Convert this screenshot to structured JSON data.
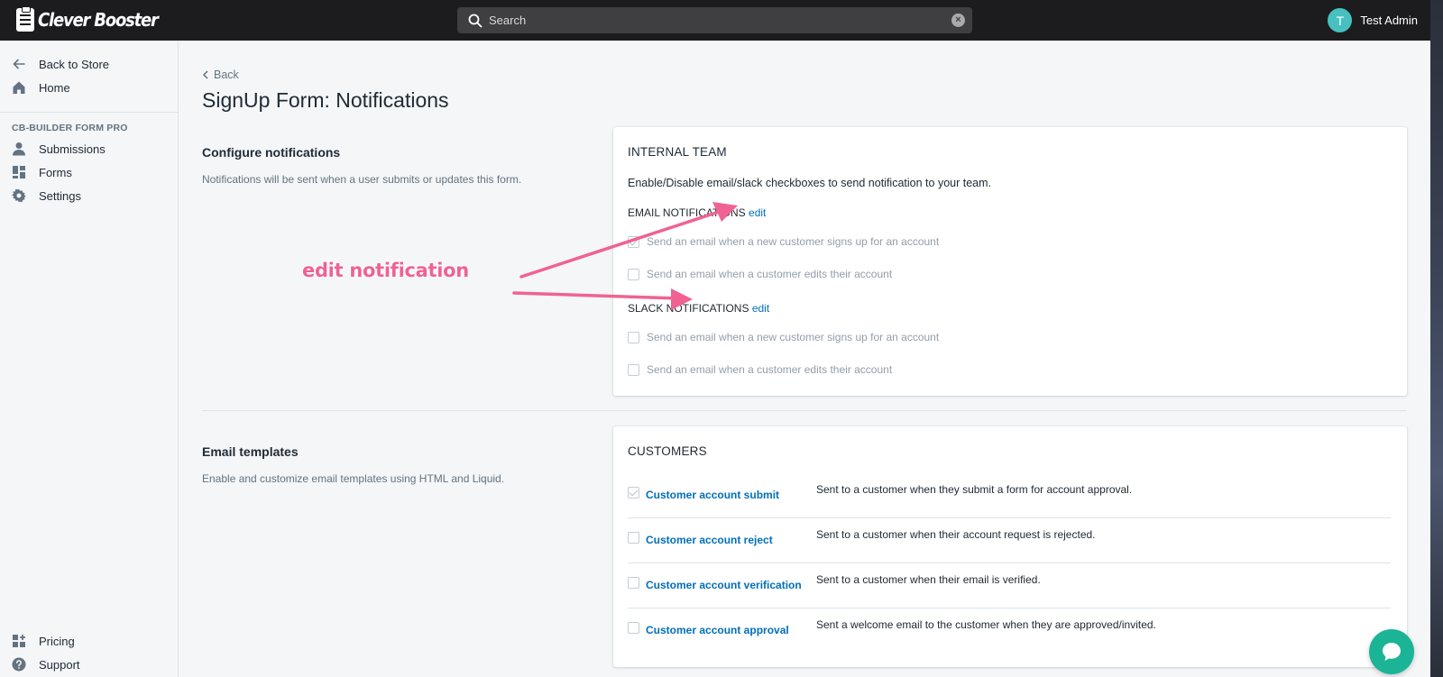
{
  "app": {
    "name": "Clever Booster"
  },
  "search": {
    "placeholder": "Search"
  },
  "user": {
    "initial": "T",
    "name": "Test Admin"
  },
  "sidebar": {
    "top_items": [
      {
        "label": "Back to Store",
        "icon": "arrow-left-icon"
      },
      {
        "label": "Home",
        "icon": "home-icon"
      }
    ],
    "section_title": "CB-BUILDER FORM PRO",
    "section_items": [
      {
        "label": "Submissions",
        "icon": "user-icon"
      },
      {
        "label": "Forms",
        "icon": "forms-icon"
      },
      {
        "label": "Settings",
        "icon": "gear-icon"
      }
    ],
    "bottom_items": [
      {
        "label": "Pricing",
        "icon": "apps-icon"
      },
      {
        "label": "Support",
        "icon": "help-icon"
      }
    ]
  },
  "page": {
    "back_label": "Back",
    "title": "SignUp Form: Notifications"
  },
  "configure": {
    "title": "Configure notifications",
    "description": "Notifications will be sent when a user submits or updates this form."
  },
  "internal_team": {
    "heading": "INTERNAL TEAM",
    "description": "Enable/Disable email/slack checkboxes to send notification to your team.",
    "email_heading": "EMAIL NOTIFICATIONS",
    "email_edit": "edit",
    "email_options": [
      {
        "label": "Send an email when a new customer signs up for an account",
        "checked": true
      },
      {
        "label": "Send an email when a customer edits their account",
        "checked": false
      }
    ],
    "slack_heading": "SLACK NOTIFICATIONS",
    "slack_edit": "edit",
    "slack_options": [
      {
        "label": "Send an email when a new customer signs up for an account",
        "checked": false
      },
      {
        "label": "Send an email when a customer edits their account",
        "checked": false
      }
    ]
  },
  "templates": {
    "title": "Email templates",
    "description": "Enable and customize email templates using HTML and Liquid."
  },
  "customers": {
    "heading": "CUSTOMERS",
    "rows": [
      {
        "name": "Customer account submit",
        "description": "Sent to a customer when they submit a form for account approval.",
        "checked": true
      },
      {
        "name": "Customer account reject",
        "description": "Sent to a customer when their account request is rejected.",
        "checked": false
      },
      {
        "name": "Customer account verification",
        "description": "Sent to a customer when their email is verified.",
        "checked": false
      },
      {
        "name": "Customer account approval",
        "description": "Sent a welcome email to the customer when they are approved/invited.",
        "checked": false
      }
    ]
  },
  "annotation": {
    "text": "edit notification",
    "color": "#f06292"
  },
  "colors": {
    "link": "#006fbb",
    "topbar": "#1c1c1e",
    "avatar": "#47c1bf",
    "chat": "#1bb496"
  }
}
